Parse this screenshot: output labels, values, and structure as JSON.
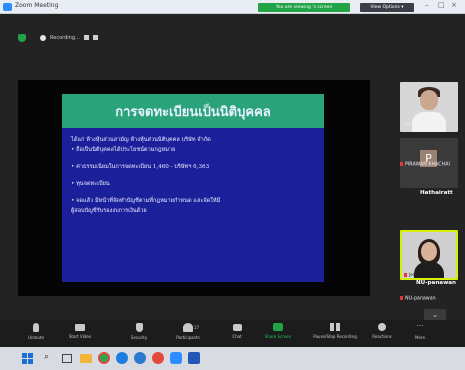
{
  "window": {
    "title": "Zoom Meeting",
    "share_banner": "You are viewing 's screen",
    "view_options": "View Options ▾"
  },
  "recording": {
    "label": "Recording..."
  },
  "slide": {
    "title": "การจดทะเบียนเป็นนิติบุคคล",
    "lines": [
      "ได้แก่ ห้างหุ้นส่วนสามัญ   ห้างหุ้นส่วนนิติบุคคล   บริษัท จำกัด",
      "• ถือเป็นนิติบุคคลได้ประโยชน์ตามกฎหมาย",
      "• ค่าธรรมเนียมในการจดทะเบียน 1,460 - บริษัทฯ 6,363",
      "• ทุนจดทะเบียน",
      "• จดแล้ว มีหน้าที่จัดทำบัญชีตามที่กฎหมายกำหนด และจัดให้มี",
      "  ผู้สอบบัญชีรับรองงบการเงินด้วย"
    ]
  },
  "participants": [
    {
      "name": "แนท",
      "type": "video"
    },
    {
      "name": "PIRAWAN KHACHAI",
      "type": "initial",
      "initial": "P",
      "muted": true
    },
    {
      "name": "Hathairatt",
      "type": "name"
    },
    {
      "name": "Jeab",
      "type": "video",
      "active": true,
      "muted": true
    },
    {
      "name": "NU-panawan",
      "type": "name"
    },
    {
      "name": "NU-panawan",
      "type": "name",
      "muted": true
    }
  ],
  "toolbar": {
    "items": [
      {
        "label": "Unmute",
        "icon": "mic-icon"
      },
      {
        "label": "Start Video",
        "icon": "video-icon"
      },
      {
        "label": "Security",
        "icon": "shield-icon"
      },
      {
        "label": "Participants",
        "icon": "participants-icon",
        "count": "17"
      },
      {
        "label": "Chat",
        "icon": "chat-icon"
      },
      {
        "label": "Share Screen",
        "icon": "share-screen-icon"
      },
      {
        "label": "Pause/Stop Recording",
        "icon": "pause-icon"
      },
      {
        "label": "Reactions",
        "icon": "reactions-icon"
      },
      {
        "label": "More",
        "icon": "more-icon"
      }
    ]
  },
  "colors": {
    "slide_bg": "#1b1f9a",
    "slide_header": "#2aa37a",
    "active_speaker_border": "#d5f000",
    "share_green": "#22a348"
  }
}
